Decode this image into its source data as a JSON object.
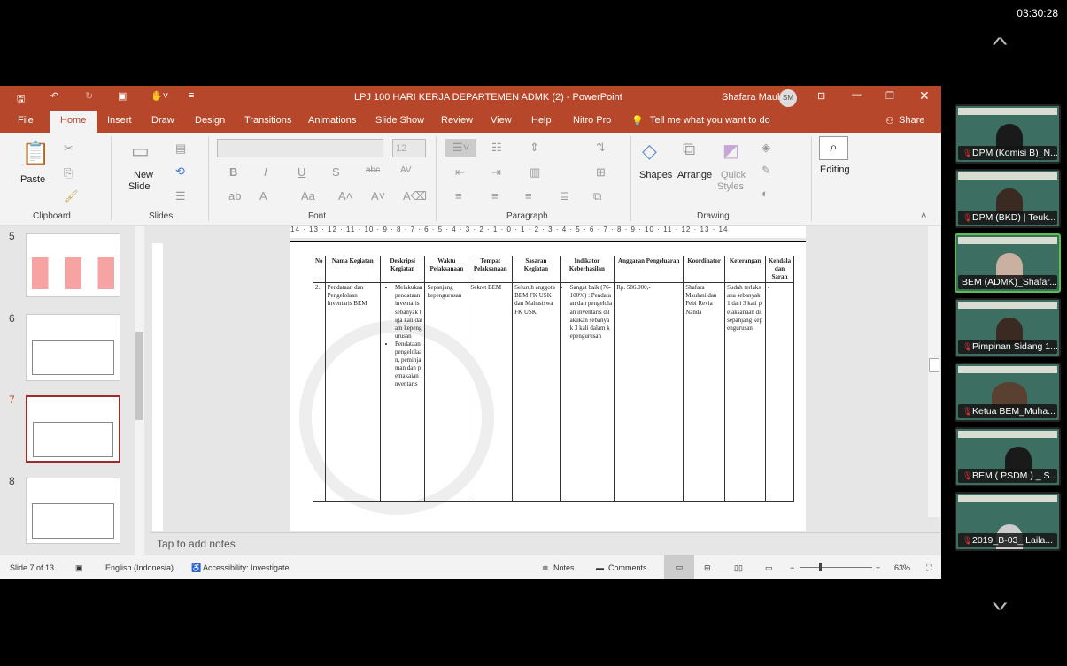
{
  "clock": "03:30:28",
  "window": {
    "title": "LPJ 100 HARI KERJA DEPARTEMEN ADMK (2)  -  PowerPoint",
    "user": "Shafara Maulani",
    "user_initials": "SM",
    "accent": "#b7472a"
  },
  "tabs": [
    "File",
    "Home",
    "Insert",
    "Draw",
    "Design",
    "Transitions",
    "Animations",
    "Slide Show",
    "Review",
    "View",
    "Help",
    "Nitro Pro"
  ],
  "tell_me": "Tell me what you want to do",
  "share": "Share",
  "ribbon": {
    "paste": "Paste",
    "new_slide": "New",
    "new_slide2": "Slide",
    "font_size": "12",
    "shapes": "Shapes",
    "arrange": "Arrange",
    "quick_styles": "Quick",
    "quick_styles2": "Styles",
    "editing": "Editing",
    "groups": [
      "Clipboard",
      "Slides",
      "Font",
      "Paragraph",
      "Drawing"
    ]
  },
  "ruler": "14 · 13 · 12 · 11 · 10 · 9 · 8 · 7 · 6 · 5 · 4 · 3 · 2 · 1 · 0 · 1 · 2 · 3 · 4 · 5 · 6 · 7 · 8 · 9 · 10 · 11 · 12 · 13 · 14",
  "thumbnails": [
    "5",
    "6",
    "7",
    "8"
  ],
  "selected_slide": "7",
  "table": {
    "headers": [
      "No",
      "Nama Kegiatan",
      "Deskripsi Kegiatan",
      "Waktu Pelaksanaan",
      "Tempat Pelaksanaan",
      "Sasaran Kegiatan",
      "Indikator Keberhasilan",
      "Anggaran Pengeluaran",
      "Koordinator",
      "Keterangan",
      "Kendala dan Saran"
    ],
    "row": {
      "no": "2.",
      "nama": "Pendataan dan Pengelolaan Inventaris BEM",
      "deskripsi": [
        "Melakukan pendataan inventaris sebanyak tiga kali dalam kepengurusan",
        "Pendataan, pengelolaan, peminjaman dan pemakaian inventaris"
      ],
      "waktu": "Sepanjang kepengurusan",
      "tempat": "Sekret BEM",
      "sasaran": "Seluruh anggota BEM FK USK dan Mahasiswa FK USK",
      "indikator": "Sangat baik (76-100%) : Pendataan dan pengelolaan inventaris dilakukan sebanyak 3 kali dalam kepengurusan",
      "anggaran": "Rp. 586.000,-",
      "koordinator": "Shafara Maulani dan Febi Revia Nanda",
      "keterangan": "Sudah terlaksana sebanyak 1 dari 3 kali pelaksanaan di sepanjang kepengurusan",
      "kendala": "-"
    }
  },
  "notes_placeholder": "Tap to add notes",
  "status": {
    "slide": "Slide 7 of 13",
    "language": "English (Indonesia)",
    "accessibility": "Accessibility: Investigate",
    "notes": "Notes",
    "comments": "Comments",
    "zoom": "63%",
    "zoom_level": 63
  },
  "participants": [
    {
      "name": "DPM (Komisi B)_N...",
      "muted": true
    },
    {
      "name": "DPM (BKD) | Teuk...",
      "muted": true
    },
    {
      "name": "BEM (ADMK)_Shafar...",
      "muted": false,
      "active": true
    },
    {
      "name": "Pimpinan Sidang 1...",
      "muted": true
    },
    {
      "name": "Ketua BEM_Muha...",
      "muted": true
    },
    {
      "name": "BEM ( PSDM ) _ S...",
      "muted": true
    },
    {
      "name": "2019_B-03_ Laila...",
      "muted": true
    }
  ]
}
